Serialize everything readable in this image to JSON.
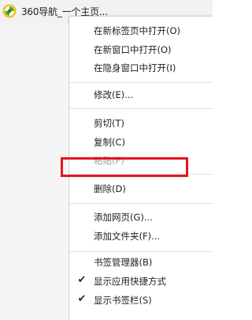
{
  "bookmark_bar": {
    "item": {
      "label": "360导航_一个主页..."
    }
  },
  "context_menu": {
    "items": [
      {
        "label": "在新标签页中打开(O)",
        "disabled": false,
        "checked": false
      },
      {
        "label": "在新窗口中打开(O)",
        "disabled": false,
        "checked": false
      },
      {
        "label": "在隐身窗口中打开(I)",
        "disabled": false,
        "checked": false
      },
      {
        "label": "修改(E)...",
        "disabled": false,
        "checked": false
      },
      {
        "label": "剪切(T)",
        "disabled": false,
        "checked": false
      },
      {
        "label": "复制(C)",
        "disabled": false,
        "checked": false
      },
      {
        "label": "粘贴(P)",
        "disabled": true,
        "checked": false
      },
      {
        "label": "删除(D)",
        "disabled": false,
        "checked": false
      },
      {
        "label": "添加网页(G)...",
        "disabled": false,
        "checked": false
      },
      {
        "label": "添加文件夹(F)...",
        "disabled": false,
        "checked": false
      },
      {
        "label": "书签管理器(B)",
        "disabled": false,
        "checked": false
      },
      {
        "label": "显示应用快捷方式",
        "disabled": false,
        "checked": true
      },
      {
        "label": "显示书签栏(S)",
        "disabled": false,
        "checked": true
      }
    ]
  },
  "annotation": {
    "highlight_color": "#e3151c"
  },
  "colors": {
    "menu_text": "#202020",
    "disabled_text": "#a0a0a0",
    "separator": "#e2e2e2"
  }
}
